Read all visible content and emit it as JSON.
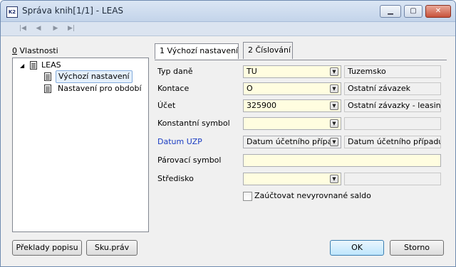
{
  "window": {
    "title": "Správa knih[1/1] - LEAS",
    "app_icon": "K2",
    "minimize_icon": "minimize-icon",
    "maximize_icon": "maximize-icon",
    "close_icon": "close-icon"
  },
  "navbar": {
    "icons": [
      "first-record-icon",
      "previous-record-icon",
      "next-record-icon",
      "last-record-icon"
    ]
  },
  "left_panel": {
    "label_hotkey": "0",
    "label_text": " Vlastnosti",
    "tree": {
      "root": "LEAS",
      "children": [
        "Výchozí nastavení",
        "Nastavení pro období"
      ],
      "selected": "Výchozí nastavení"
    }
  },
  "tabs": [
    {
      "label": "1 Výchozí nastavení",
      "active": true
    },
    {
      "label": "2 Číslování",
      "active": false
    }
  ],
  "form": {
    "typ_dane": {
      "label": "Typ daně",
      "value": "TU",
      "desc": "Tuzemsko"
    },
    "kontace": {
      "label": "Kontace",
      "value": "O",
      "desc": "Ostatní závazek"
    },
    "ucet": {
      "label": "Účet",
      "value": "325900",
      "desc": "Ostatní závazky - leasing"
    },
    "konstantni_symbol": {
      "label": "Konstantní symbol",
      "value": "",
      "desc": ""
    },
    "datum_uzp": {
      "label": "Datum UZP",
      "value": "Datum účetního přípa",
      "desc": "Datum účetního případu"
    },
    "parovaci_symbol": {
      "label": "Párovací symbol",
      "value": ""
    },
    "stredisko": {
      "label": "Středisko",
      "value": "",
      "desc": ""
    },
    "checkbox": {
      "label": "Zaúčtovat nevyrovnané saldo",
      "checked": false
    }
  },
  "buttons": {
    "preklady": "Překlady popisu",
    "skuprav": "Sku.práv",
    "ok": "OK",
    "storno": "Storno"
  },
  "colors": {
    "field_bg": "#fffde0",
    "link_label": "#1a3cc2",
    "titlebar": "#c3d4ea"
  }
}
